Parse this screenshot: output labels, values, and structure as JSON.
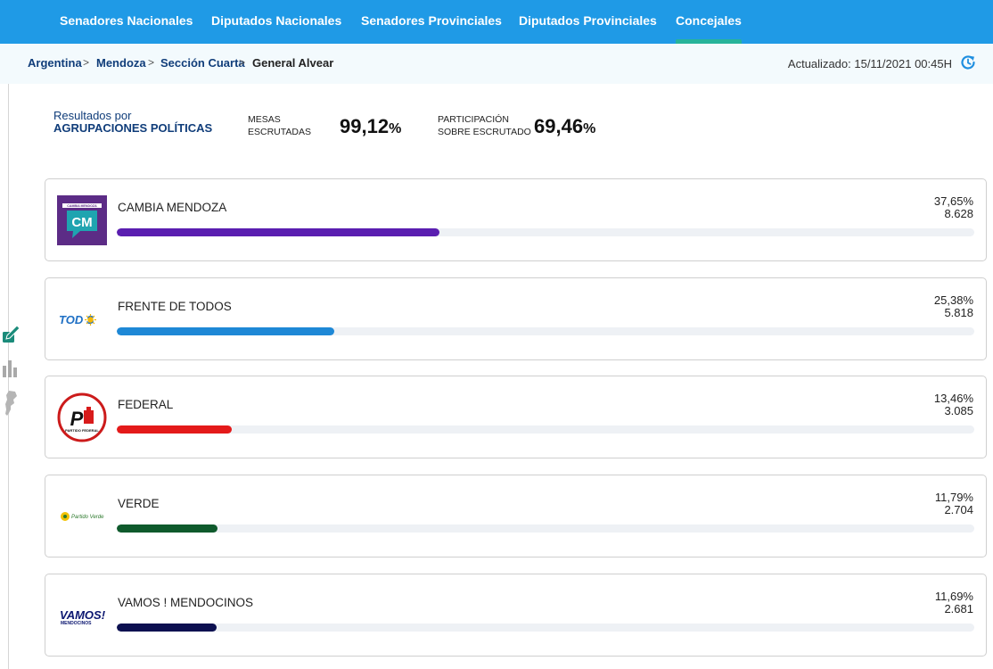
{
  "nav": {
    "tabs": [
      {
        "label": "Senadores Nacionales"
      },
      {
        "label": "Diputados Nacionales"
      },
      {
        "label": "Senadores Provinciales"
      },
      {
        "label": "Diputados Provinciales"
      },
      {
        "label": "Concejales",
        "active": true
      }
    ]
  },
  "breadcrumb": {
    "items": [
      "Argentina",
      "Mendoza",
      "Sección Cuarta",
      "General Alvear"
    ],
    "separator": ">"
  },
  "updated": "Actualizado: 15/11/2021 00:45H",
  "summary": {
    "title_line1": "Resultados por",
    "title_line2": "AGRUPACIONES POLÍTICAS",
    "mesas_label": [
      "MESAS",
      "ESCRUTADAS"
    ],
    "mesas_value": "99,12",
    "participacion_label": [
      "PARTICIPACIÓN",
      "SOBRE ESCRUTADO"
    ],
    "participacion_value": "69,46",
    "percent_sign": "%"
  },
  "logo_text": {
    "cm_banner": "CAMBIA MENDOZA",
    "cm": "CM",
    "todos": "TOD S",
    "pf": "PARTIDO FEDERAL",
    "verde": "Partido Verde",
    "vamos": "VAMOS!",
    "vamos_sub": "MENDOCINOS"
  },
  "parties": [
    {
      "name": "CAMBIA MENDOZA",
      "pct": "37,65%",
      "votes": "8.628",
      "share": 0.3765,
      "color": "#5a1eb0",
      "logo": "cambia-mendoza-logo"
    },
    {
      "name": "FRENTE DE TODOS",
      "pct": "25,38%",
      "votes": "5.818",
      "share": 0.2538,
      "color": "#1e88d6",
      "logo": "frente-de-todos-logo"
    },
    {
      "name": "FEDERAL",
      "pct": "13,46%",
      "votes": "3.085",
      "share": 0.1346,
      "color": "#e41a1a",
      "logo": "partido-federal-logo"
    },
    {
      "name": "VERDE",
      "pct": "11,79%",
      "votes": "2.704",
      "share": 0.1179,
      "color": "#0f5a2c",
      "logo": "partido-verde-logo"
    },
    {
      "name": "VAMOS ! MENDOCINOS",
      "pct": "11,69%",
      "votes": "2.681",
      "share": 0.1169,
      "color": "#0c1050",
      "logo": "vamos-mendocinos-logo"
    }
  ]
}
